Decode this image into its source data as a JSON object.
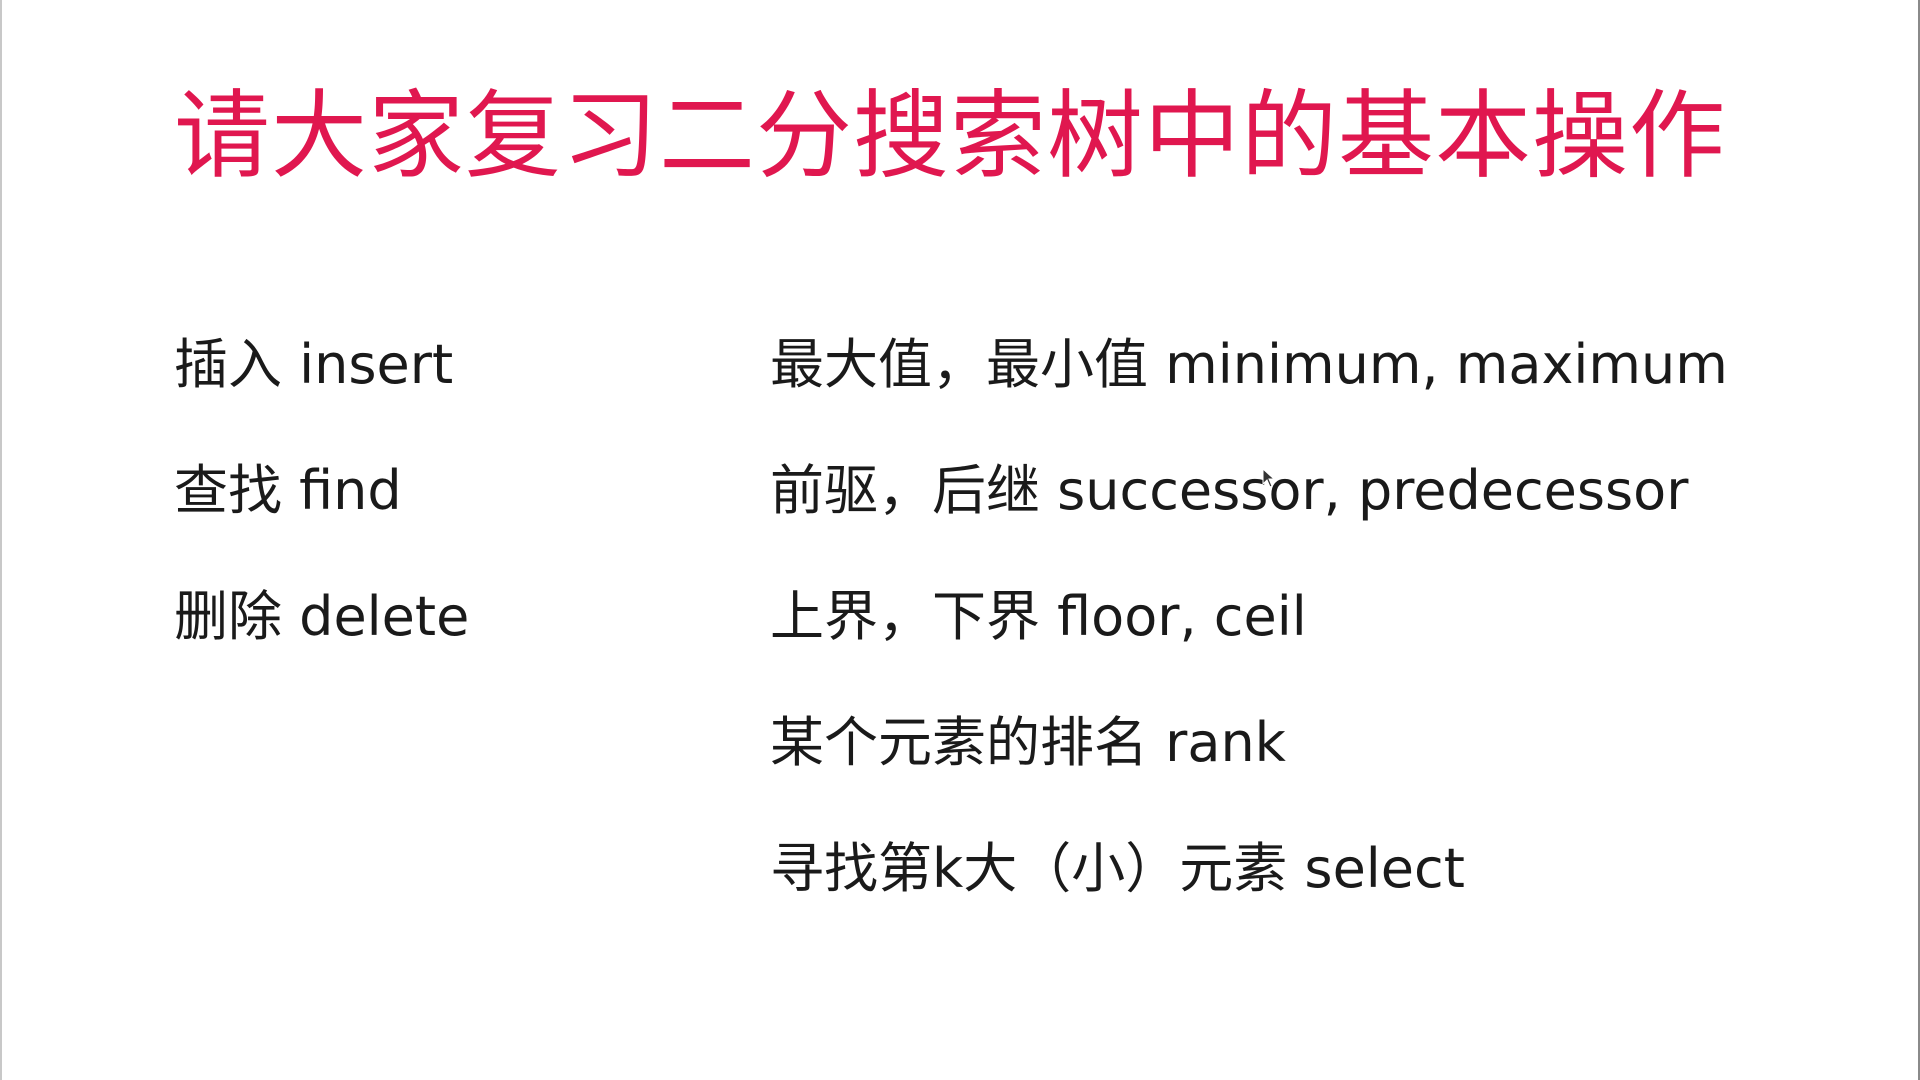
{
  "colors": {
    "title": "#e0174f",
    "text": "#1a1a1a",
    "background": "#ffffff"
  },
  "slide": {
    "title": "请大家复习二分搜索树中的基本操作",
    "left_items": [
      "插入 insert",
      "查找 find",
      "删除 delete"
    ],
    "right_items": [
      "最大值，最小值 minimum, maximum",
      "前驱，后继 successor, predecessor",
      "上界，下界 floor, ceil",
      "某个元素的排名 rank",
      "寻找第k大（小）元素 select"
    ]
  },
  "cursor_icon": "mouse-pointer-icon"
}
